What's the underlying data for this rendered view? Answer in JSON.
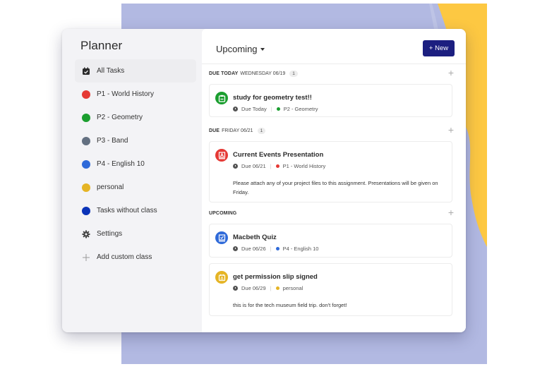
{
  "colors": {
    "accent": "#1c1f80",
    "background_lavender": "#b2b9e2",
    "background_yellow": "#fdc842",
    "p1": "#e53935",
    "p2": "#1b9e2f",
    "p3": "#637081",
    "p4": "#2f6ad9",
    "personal": "#e5b425",
    "no_class": "#0a33b8"
  },
  "sidebar": {
    "title": "Planner",
    "items": [
      {
        "label": "All Tasks",
        "icon": "calendar-check-icon",
        "active": true
      },
      {
        "label": "P1 - World History",
        "dot": "#e53935"
      },
      {
        "label": "P2 - Geometry",
        "dot": "#1b9e2f"
      },
      {
        "label": "P3 - Band",
        "dot": "#637081"
      },
      {
        "label": "P4 - English 10",
        "dot": "#2f6ad9"
      },
      {
        "label": "personal",
        "dot": "#e5b425"
      },
      {
        "label": "Tasks without class",
        "dot": "#0a33b8"
      },
      {
        "label": "Settings",
        "icon": "gear-icon"
      },
      {
        "label": "Add custom class",
        "icon": "plus-icon"
      }
    ]
  },
  "main": {
    "view_title": "Upcoming",
    "new_button": "+ New",
    "sections": [
      {
        "strong": "DUE TODAY",
        "normal": "WEDNESDAY 06/19",
        "count": "1"
      },
      {
        "strong": "DUE",
        "normal": "FRIDAY 06/21",
        "count": "1"
      },
      {
        "strong": "UPCOMING",
        "normal": "",
        "count": ""
      }
    ],
    "tasks": [
      {
        "title": "study for geometry test!!",
        "due": "Due Today",
        "class": "P2 - Geometry",
        "color": "#1b9e2f",
        "icon": "clipboard-icon",
        "description": ""
      },
      {
        "title": "Current Events Presentation",
        "due": "Due 06/21",
        "class": "P1 - World History",
        "color": "#e53935",
        "icon": "presentation-icon",
        "description": "Please attach any of your project files to this assignment. Presentations will be given on Friday."
      },
      {
        "title": "Macbeth Quiz",
        "due": "Due 06/26",
        "class": "P4 - English 10",
        "color": "#2f6ad9",
        "icon": "quiz-icon",
        "description": ""
      },
      {
        "title": "get permission slip signed",
        "due": "Due 06/29",
        "class": "personal",
        "color": "#e5b425",
        "icon": "document-icon",
        "description": "this is for the tech museum field trip. don't forget!"
      }
    ]
  }
}
